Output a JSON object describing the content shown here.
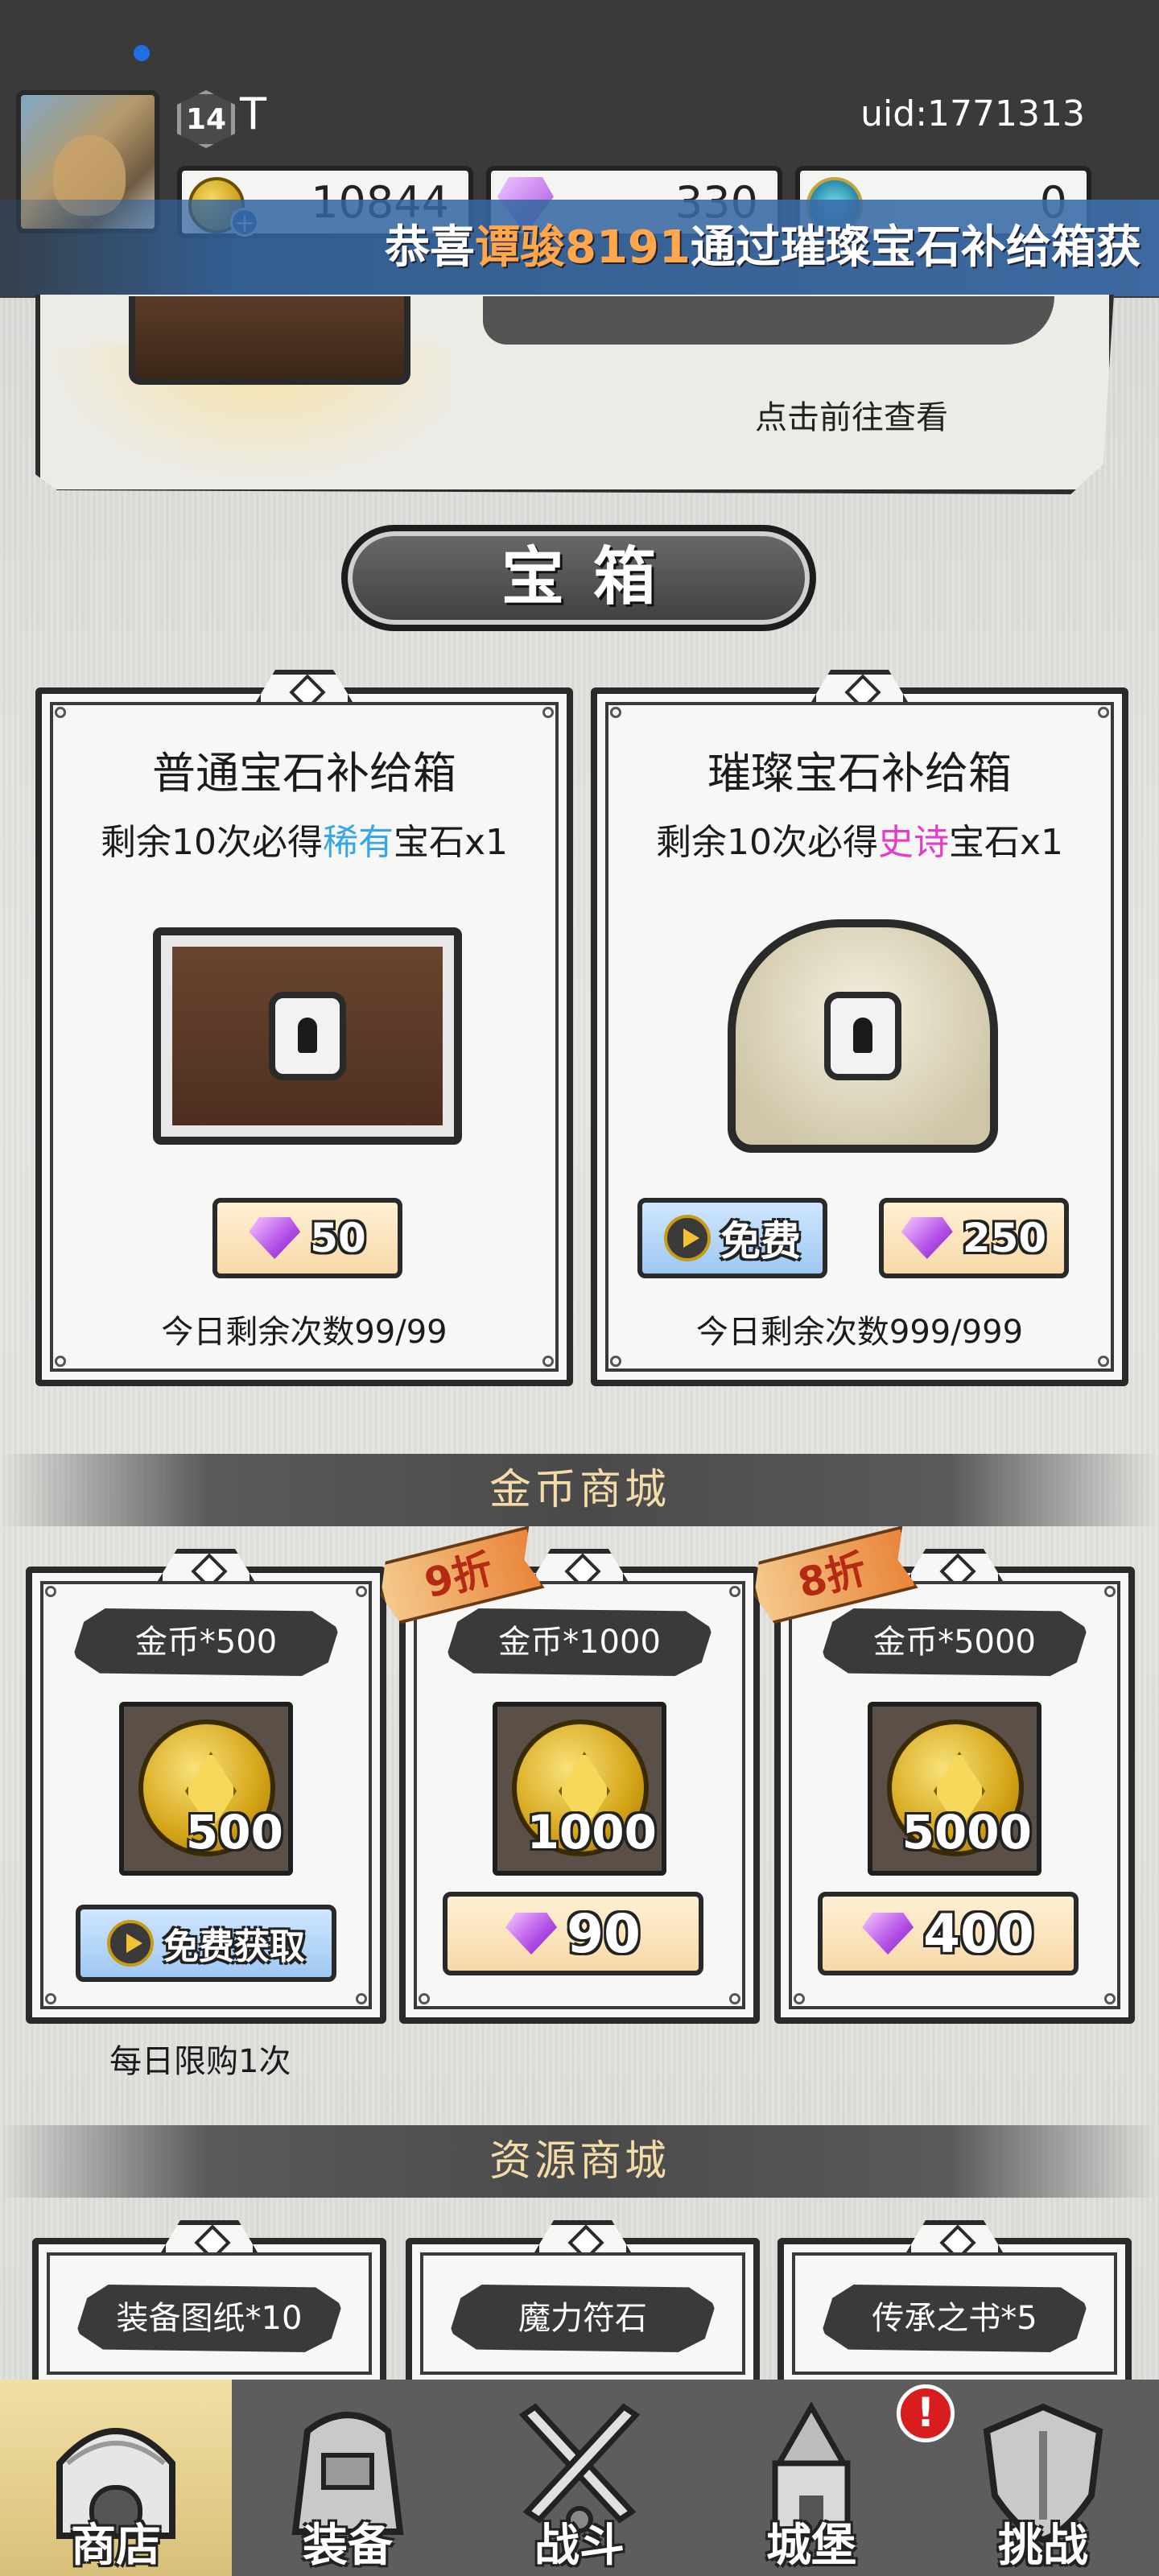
{
  "header": {
    "player_level": "14",
    "player_name": "T",
    "uid": "uid:1771313",
    "gold": "10844",
    "gems": "330",
    "crystals": "0"
  },
  "marquee": {
    "prefix": "恭喜",
    "player": "谭骏8191",
    "suffix": "通过璀璨宝石补给箱获"
  },
  "banner": {
    "hint": "点击前往查看"
  },
  "chest_section": {
    "title": "宝箱",
    "boxes": [
      {
        "title": "普通宝石补给箱",
        "sub_prefix": "剩余10次必得",
        "sub_quality": "稀有",
        "sub_suffix": "宝石x1",
        "price": "50",
        "remain": "今日剩余次数99/99"
      },
      {
        "title": "璀璨宝石补给箱",
        "sub_prefix": "剩余10次必得",
        "sub_quality": "史诗",
        "sub_suffix": "宝石x1",
        "free_label": "免费",
        "price": "250",
        "remain": "今日剩余次数999/999"
      }
    ]
  },
  "gold_shop": {
    "title": "金币商城",
    "items": [
      {
        "label": "金币*500",
        "amount": "500",
        "button": "免费获取",
        "note": "每日限购1次"
      },
      {
        "label": "金币*1000",
        "amount": "1000",
        "price": "90",
        "discount": "9折"
      },
      {
        "label": "金币*5000",
        "amount": "5000",
        "price": "400",
        "discount": "8折"
      }
    ]
  },
  "resource_shop": {
    "title": "资源商城",
    "items": [
      {
        "label": "装备图纸*10"
      },
      {
        "label": "魔力符石"
      },
      {
        "label": "传承之书*5"
      }
    ]
  },
  "nav": {
    "items": [
      {
        "label": "商店",
        "icon": "shop-icon"
      },
      {
        "label": "装备",
        "icon": "backpack-icon"
      },
      {
        "label": "战斗",
        "icon": "crossed-swords-icon"
      },
      {
        "label": "城堡",
        "icon": "castle-icon"
      },
      {
        "label": "挑战",
        "icon": "shield-icon"
      }
    ],
    "alert": "!"
  },
  "colors": {
    "rare": "#38a6e6",
    "epic": "#e23cc9",
    "marquee_highlight": "#ffa74a",
    "section_title": "#f3dca8"
  }
}
